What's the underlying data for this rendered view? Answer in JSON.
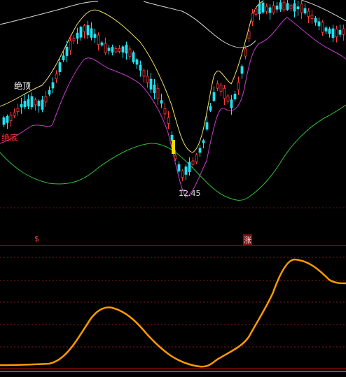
{
  "labels": {
    "top_extreme": "绝顶",
    "bottom_extreme": "绝底",
    "low_price": "12.45",
    "left_marker": "$",
    "right_marker": "涨"
  },
  "colors": {
    "background": "#000000",
    "upper_envelope": "#f5e36b",
    "lower_envelope": "#c93bd1",
    "slow_ma": "#2fbf3a",
    "grey_curve": "#d8d8d8",
    "oscillator": "#ff9900",
    "candle_up": "#ff3b3b",
    "candle_down": "#22e0f0",
    "grid_dashed": "#8a1a1a",
    "panel_divider": "#c01010",
    "highlight_bar": "#ffd700"
  },
  "chart_data": {
    "type": "candlestick+oscillator",
    "price_panel": {
      "marked_low": 12.45,
      "series": [
        "upper_envelope",
        "lower_envelope",
        "slow_ma",
        "grey_curve"
      ]
    },
    "oscillator_panel": {
      "values": [
        2,
        3,
        6,
        20,
        48,
        65,
        60,
        45,
        30,
        14,
        5,
        2,
        12,
        30,
        55,
        78,
        92,
        90,
        82,
        78
      ]
    }
  }
}
